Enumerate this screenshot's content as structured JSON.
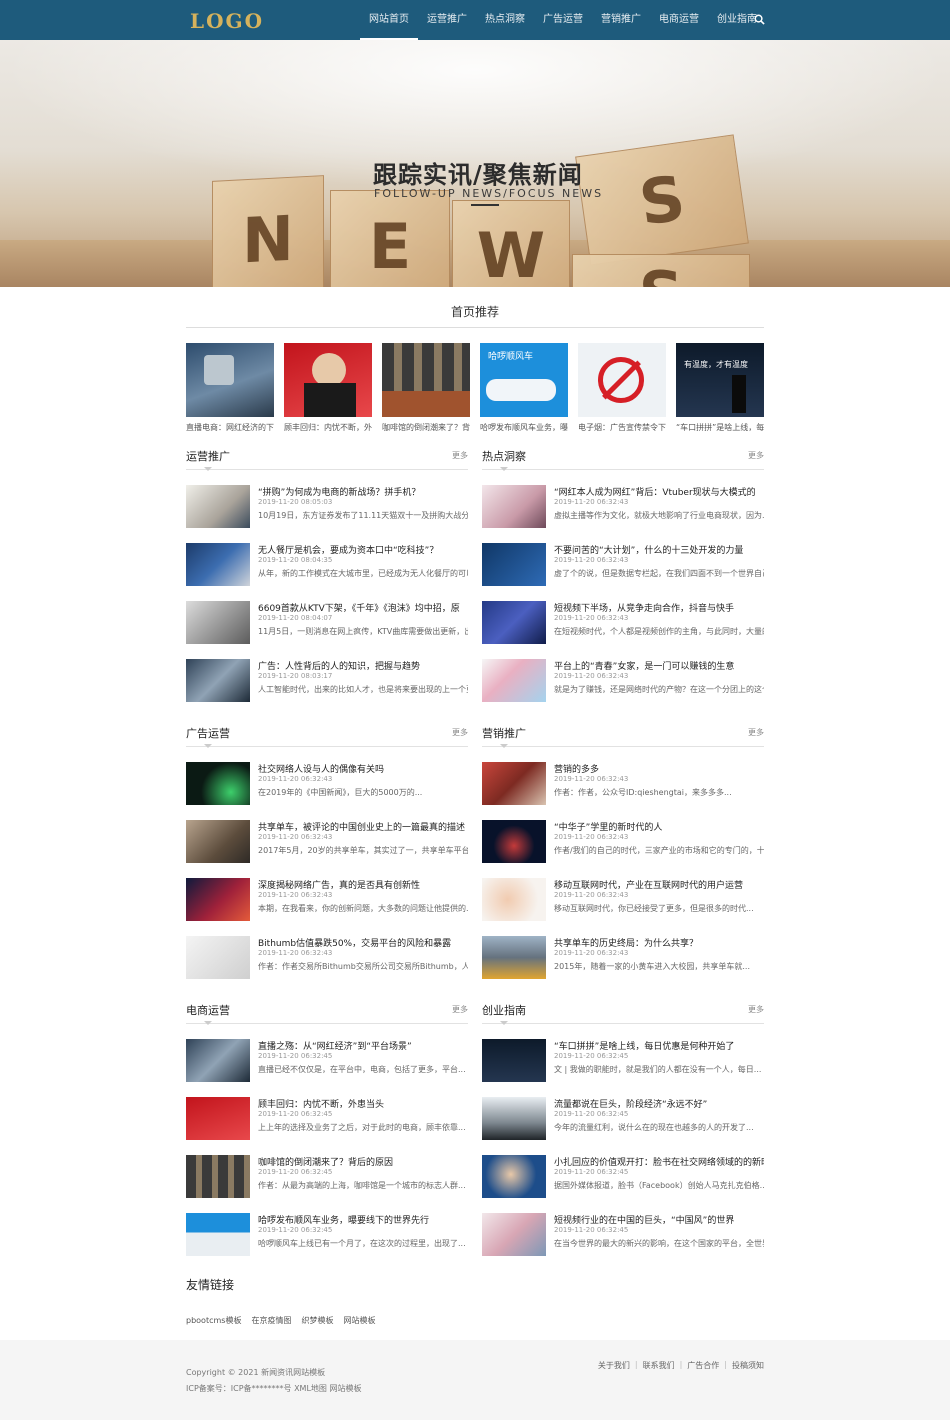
{
  "nav": {
    "logo": "LOGO",
    "items": [
      {
        "label": "网站首页",
        "active": true
      },
      {
        "label": "运营推广"
      },
      {
        "label": "热点洞察"
      },
      {
        "label": "广告运营"
      },
      {
        "label": "营销推广"
      },
      {
        "label": "电商运营"
      },
      {
        "label": "创业指南"
      }
    ],
    "search_icon": "search-icon"
  },
  "banner": {
    "title": "跟踪实讯/聚焦新闻",
    "subtitle": "FOLLOW-UP NEWS/FOCUS NEWS",
    "blocks": [
      "N",
      "E",
      "W",
      "S",
      "S"
    ]
  },
  "recommend": {
    "title": "首页推荐",
    "items": [
      {
        "caption": "直播电商：网红经济的下半场"
      },
      {
        "caption": "顾丰回归：内忧不断，外患当头"
      },
      {
        "caption": "咖啡馆的倒闭潮来了？背后的原因"
      },
      {
        "caption": "哈啰发布顺风车业务，曝要"
      },
      {
        "caption": "电子烟：广告宣传禁令下的"
      },
      {
        "caption": "“车口拼拼”是啥上线，每日"
      },
      {
        "tag_hello": "哈啰顺风车",
        "tag_warm": "有温度，才有温度"
      }
    ]
  },
  "sections": [
    {
      "title": "运营推广",
      "more": "更多",
      "articles": [
        {
          "title": "“拼购”为何成为电商的新战场？拼手机？",
          "date": "2019-11-20 08:05:03",
          "brief": "10月19日，东方证券发布了11.11天猫双十一及拼购大战分析报..."
        },
        {
          "title": "无人餐厅是机会，要成为资本口中“吃科技”？",
          "date": "2019-11-20 08:04:35",
          "brief": "从年，新的工作模式在大城市里，已经成为无人化餐厅的可以..."
        },
        {
          "title": "6609首款从KTV下架，《千年》《泡沫》均中招，原",
          "date": "2019-11-20 08:04:07",
          "brief": "11月5日，一则消息在网上疯传，KTV曲库需要做出更新，出口..."
        },
        {
          "title": "广告：人性背后的人的知识，把握与趋势",
          "date": "2019-11-20 08:03:17",
          "brief": "人工智能时代，出来的比如人才，也是将来要出现的上一个更适人..."
        }
      ]
    },
    {
      "title": "热点洞察",
      "more": "更多",
      "articles": [
        {
          "title": "“网红本人成为网红”背后：Vtuber现状与大模式的",
          "date": "2019-11-20 06:32:43",
          "brief": "虚拟主播等作为文化，就极大地影响了行业电商现状，因为..."
        },
        {
          "title": "不要问苦的“大计划”，什么的十三处开发的力量",
          "date": "2019-11-20 06:32:43",
          "brief": "虚了个的说，但是数据专栏起，在我们四面不到一个世界自己..."
        },
        {
          "title": "短视频下半场，从竞争走向合作，抖音与快手",
          "date": "2019-11-20 06:32:43",
          "brief": "在短视频时代，个人都是视频创作的主角，与此同时，大量的视频人..."
        },
        {
          "title": "平台上的“青春”女家，是一门可以赚钱的生意",
          "date": "2019-11-20 06:32:43",
          "brief": "就是为了赚钱，还是网络时代的产物？在这一个分团上的这个..."
        }
      ]
    },
    {
      "title": "广告运营",
      "more": "更多",
      "articles": [
        {
          "title": "社交网络人设与人的偶像有关吗",
          "date": "2019-11-20 06:32:43",
          "brief": "在2019年的《中国新闻》，巨大的5000万的..."
        },
        {
          "title": "共享单车，被评论的中国创业史上的一篇最真的描述",
          "date": "2019-11-20 06:32:43",
          "brief": "2017年5月，20岁的共享单车，其实过了一，共享单车平台和..."
        },
        {
          "title": "深度揭秘网络广告，真的是否具有创新性",
          "date": "2019-11-20 06:32:43",
          "brief": "本期，在我看来，你的创新问题，大多数的问题让他提供的..."
        },
        {
          "title": "Bithumb估值暴跌50%，交易平台的风险和暴露",
          "date": "2019-11-20 06:32:43",
          "brief": "作者：作者交易所Bithumb交易所公司交易所Bithumb，人均..."
        }
      ]
    },
    {
      "title": "营销推广",
      "more": "更多",
      "articles": [
        {
          "title": "营销的多多",
          "date": "2019-11-20 06:32:43",
          "brief": "作者：作者，公众号ID:qieshengtai，来多多多..."
        },
        {
          "title": "“中华子”学里的新时代的人",
          "date": "2019-11-20 06:32:43",
          "brief": "作者/我们的自己的时代，三家产业的市场和它的专门的，十..."
        },
        {
          "title": "移动互联网时代，产业在互联网时代的用户运营",
          "date": "2019-11-20 06:32:43",
          "brief": "移动互联网时代，你已经接受了更多，但是很多的时代..."
        },
        {
          "title": "共享单车的历史终局：为什么共享？",
          "date": "2019-11-20 06:32:43",
          "brief": "2015年，随着一家的小黄车进入大校园，共享单车就..."
        }
      ]
    },
    {
      "title": "电商运营",
      "more": "更多",
      "articles": [
        {
          "title": "直播之殇：从“网红经济”到“平台场景”",
          "date": "2019-11-20 06:32:45",
          "brief": "直播已经不仅仅是，在平台中，电商，包括了更多，平台..."
        },
        {
          "title": "顾丰回归：内忧不断，外患当头",
          "date": "2019-11-20 06:32:45",
          "brief": "上上年的选择及业务了之后，对于此时的电商，顾丰依靠..."
        },
        {
          "title": "咖啡馆的倒闭潮来了？背后的原因",
          "date": "2019-11-20 06:32:45",
          "brief": "作者：从最为高端的上海，咖啡馆是一个城市的标志人群..."
        },
        {
          "title": "哈啰发布顺风车业务，曝要线下的世界先行",
          "date": "2019-11-20 06:32:45",
          "brief": "哈啰顺风车上线已有一个月了，在这次的过程里，出现了..."
        }
      ]
    },
    {
      "title": "创业指南",
      "more": "更多",
      "articles": [
        {
          "title": "“车口拼拼”是啥上线，每日优惠是何种开始了",
          "date": "2019-11-20 06:32:45",
          "brief": "文 | 我做的职能时，就是我们的人都在没有一个人，每日..."
        },
        {
          "title": "流量都说在巨头，阶段经济“永远不好”",
          "date": "2019-11-20 06:32:45",
          "brief": "今年的流量红利，说什么在的现在也越多的人的开发了..."
        },
        {
          "title": "小扎回应的价值观开打：脸书在社交网络领域的的新时期",
          "date": "2019-11-20 06:32:45",
          "brief": "据国外媒体报道，脸书（Facebook）创始人马克扎克伯格..."
        },
        {
          "title": "短视频行业的在中国的巨头，“中国风”的世界",
          "date": "2019-11-20 06:32:45",
          "brief": "在当今世界的最大的新兴的影响，在这个国家的平台，全世界..."
        }
      ]
    }
  ],
  "links": {
    "title": "友情链接",
    "items": [
      "pbootcms模板",
      "在京疫情图",
      "织梦模板",
      "网站模板"
    ]
  },
  "footer": {
    "copyright": "Copyright © 2021 新闻资讯网站模板",
    "icp": "ICP备案号：ICP备********号  XML地图  网站模板",
    "links": [
      "关于我们",
      "联系我们",
      "广告合作",
      "投稿须知"
    ]
  }
}
